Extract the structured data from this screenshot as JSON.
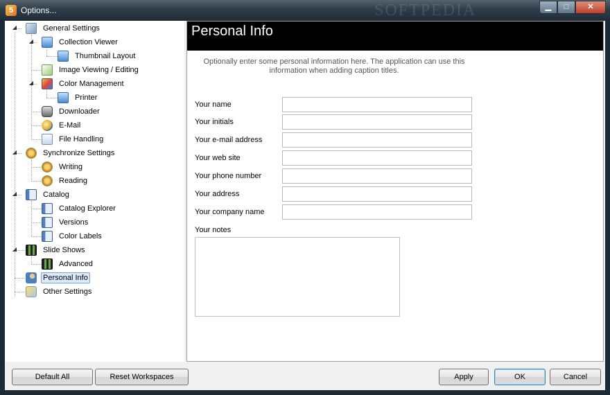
{
  "window": {
    "title": "Options...",
    "watermark": "SOFTPEDIA",
    "controls": {
      "minimize": "▁",
      "maximize": "□",
      "close": "✕"
    }
  },
  "tree": {
    "expander_symbol": "◢",
    "nodes": [
      {
        "label": "General Settings",
        "icon": "settings-icon"
      },
      {
        "label": "Collection Viewer",
        "icon": "monitor-icon"
      },
      {
        "label": "Thumbnail Layout",
        "icon": "monitor-icon"
      },
      {
        "label": "Image Viewing / Editing",
        "icon": "image-icon"
      },
      {
        "label": "Color Management",
        "icon": "color-icon"
      },
      {
        "label": "Printer",
        "icon": "monitor-icon"
      },
      {
        "label": "Downloader",
        "icon": "camera-icon"
      },
      {
        "label": "E-Mail",
        "icon": "email-icon"
      },
      {
        "label": "File Handling",
        "icon": "file-icon"
      },
      {
        "label": "Synchronize Settings",
        "icon": "sync-icon"
      },
      {
        "label": "Writing",
        "icon": "sync-icon"
      },
      {
        "label": "Reading",
        "icon": "sync-icon"
      },
      {
        "label": "Catalog",
        "icon": "catalog-icon"
      },
      {
        "label": "Catalog Explorer",
        "icon": "catalog-icon"
      },
      {
        "label": "Versions",
        "icon": "catalog-icon"
      },
      {
        "label": "Color Labels",
        "icon": "catalog-icon"
      },
      {
        "label": "Slide Shows",
        "icon": "film-icon"
      },
      {
        "label": "Advanced",
        "icon": "film-icon"
      },
      {
        "label": "Personal Info",
        "icon": "person-icon",
        "selected": true
      },
      {
        "label": "Other Settings",
        "icon": "other-settings-icon"
      }
    ]
  },
  "panel": {
    "title": "Personal Info",
    "intro_line1": "Optionally enter some personal information here. The application can use this",
    "intro_line2": "information when adding caption titles.",
    "fields": [
      {
        "label": "Your name",
        "value": ""
      },
      {
        "label": "Your initials",
        "value": ""
      },
      {
        "label": "Your e-mail address",
        "value": ""
      },
      {
        "label": "Your web site",
        "value": ""
      },
      {
        "label": "Your phone number",
        "value": ""
      },
      {
        "label": "Your address",
        "value": ""
      },
      {
        "label": "Your company name",
        "value": ""
      }
    ],
    "notes_label": "Your notes",
    "notes_value": ""
  },
  "buttons": {
    "default_all": "Default All",
    "reset_workspaces": "Reset Workspaces",
    "apply": "Apply",
    "ok": "OK",
    "cancel": "Cancel"
  }
}
